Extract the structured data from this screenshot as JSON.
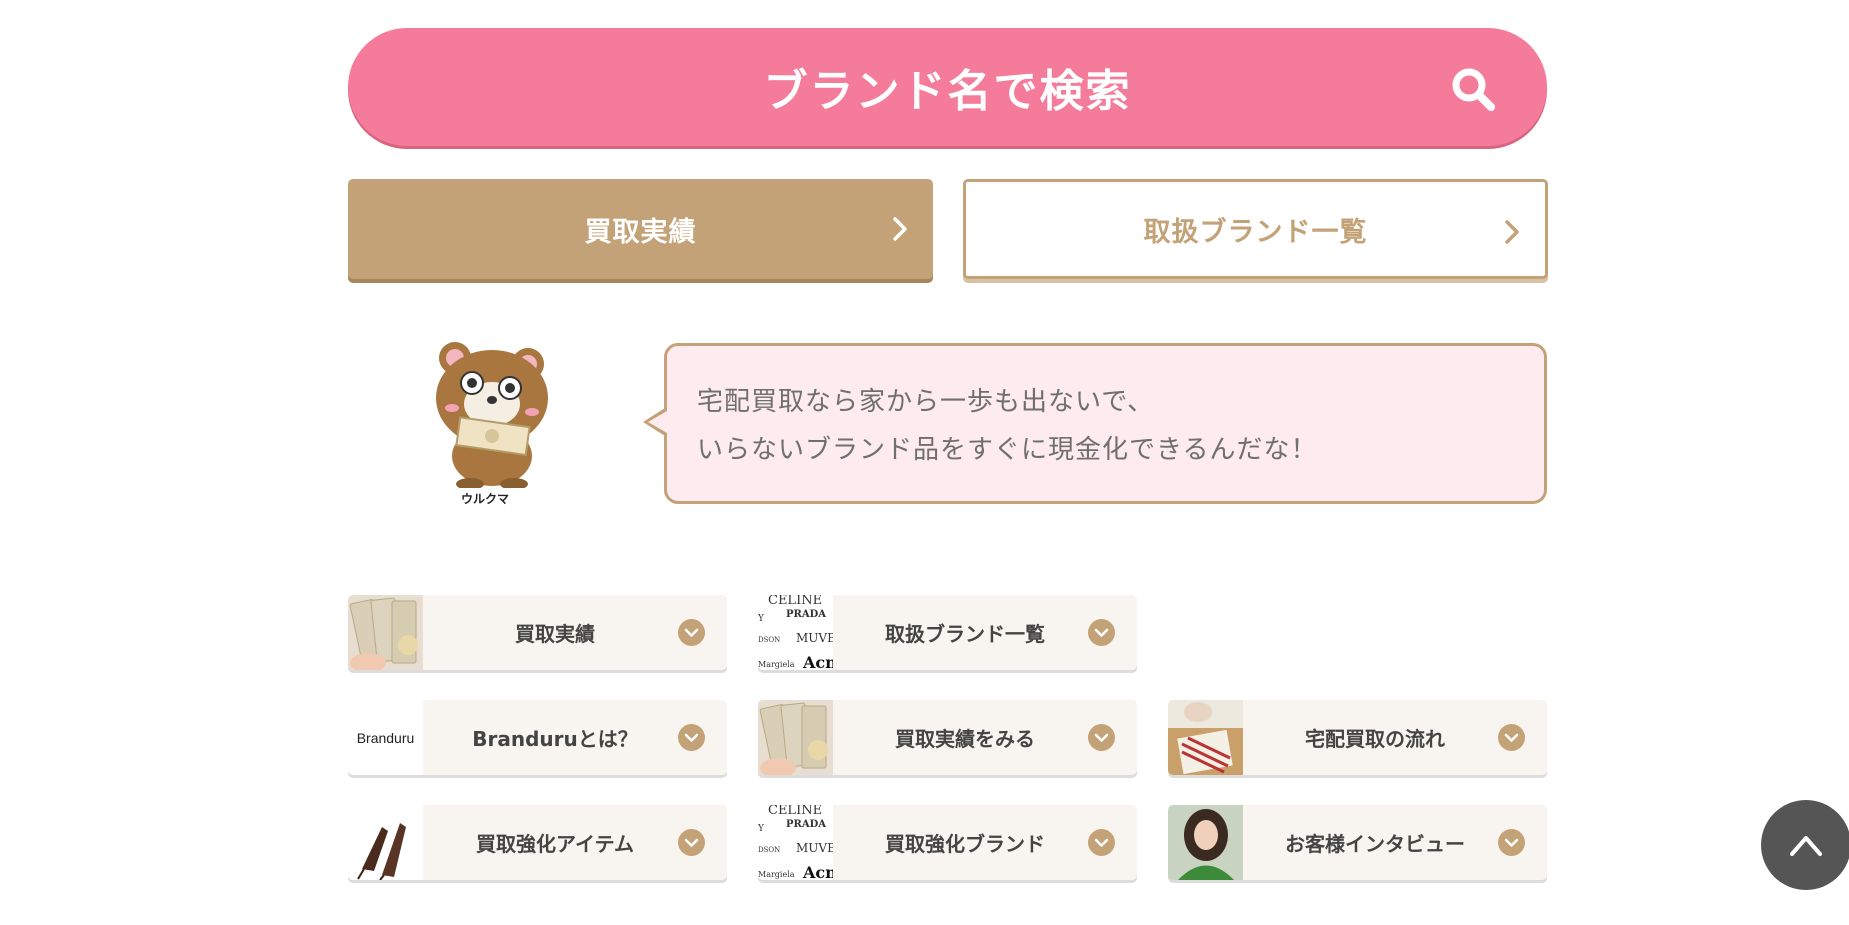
{
  "search": {
    "label": "ブランド名で検索",
    "icon": "search-icon"
  },
  "buttons": {
    "results": {
      "label": "買取実績",
      "icon": "chevron-right-icon"
    },
    "brands": {
      "label": "取扱ブランド一覧",
      "icon": "chevron-right-icon"
    }
  },
  "mascot": {
    "name": "ウルクマ"
  },
  "bubble": {
    "line1": "宅配買取なら家から一歩も出ないで、",
    "line2": "いらないブランド品をすぐに現金化できるんだな！"
  },
  "brand_text": {
    "celine": "CELINE",
    "prada": "PRADA",
    "muve": "MUVE",
    "dson": "DSON",
    "margiela": "Margiela",
    "acne": "Acne",
    "y": "Y"
  },
  "cards": [
    {
      "label": "買取実績",
      "thumb": "cash-photo"
    },
    {
      "label": "取扱ブランド一覧",
      "thumb": "brand-logos"
    },
    {
      "label": "Branduruとは？",
      "thumb": "branduru-logo",
      "thumb_text": "Branduru"
    },
    {
      "label": "買取実績をみる",
      "thumb": "cash-photo"
    },
    {
      "label": "宅配買取の流れ",
      "thumb": "box-photo"
    },
    {
      "label": "買取強化アイテム",
      "thumb": "shoes-photo"
    },
    {
      "label": "買取強化ブランド",
      "thumb": "brand-logos"
    },
    {
      "label": "お客様インタビュー",
      "thumb": "customer-photo"
    }
  ],
  "colors": {
    "pink": "#f47b9a",
    "gold": "#c4a277",
    "bubble_bg": "#fdebf0",
    "card_bg": "#f8f5f1"
  },
  "scroll_top": {
    "icon": "chevron-up-icon"
  }
}
